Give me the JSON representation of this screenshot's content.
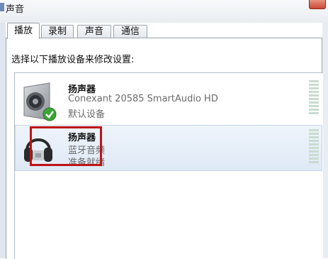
{
  "window": {
    "title": "声音"
  },
  "tabs": [
    {
      "label": "播放"
    },
    {
      "label": "录制"
    },
    {
      "label": "声音"
    },
    {
      "label": "通信"
    }
  ],
  "instruction": "选择以下播放设备来修改设置:",
  "devices": [
    {
      "name": "扬声器",
      "line1": "Conexant 20585 SmartAudio HD",
      "line2": "默认设备",
      "icon": "speaker-icon",
      "status_icon": "checkmark-icon"
    },
    {
      "name": "扬声器",
      "line1": "蓝牙音频",
      "line2": "准备就绪",
      "icon": "headphones-icon",
      "highlighted": true
    }
  ],
  "colors": {
    "highlight_border": "#c01313",
    "selected_row": "#e3ecf7",
    "check_green": "#3aa636"
  }
}
